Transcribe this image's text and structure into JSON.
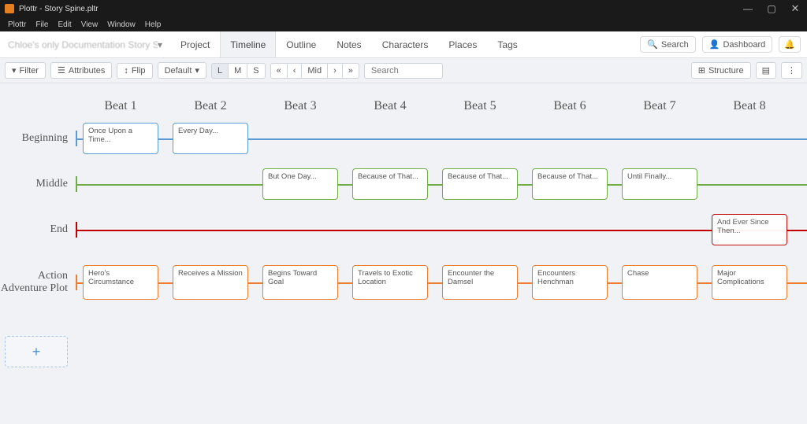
{
  "window": {
    "title": "Plottr - Story Spine.pltr",
    "controls": {
      "min": "—",
      "max": "▢",
      "close": "✕"
    }
  },
  "menubar": [
    "Plottr",
    "File",
    "Edit",
    "View",
    "Window",
    "Help"
  ],
  "mainnav": {
    "doc_title": "Chloe's only Documentation Story Spine...",
    "caret": "▾",
    "items": [
      "Project",
      "Timeline",
      "Outline",
      "Notes",
      "Characters",
      "Places",
      "Tags"
    ],
    "active": "Timeline",
    "right": {
      "search_label": "Search",
      "dashboard_label": "Dashboard",
      "bell": "🔔"
    }
  },
  "toolbar": {
    "filter": "Filter",
    "attributes": "Attributes",
    "flip": "Flip",
    "default": "Default",
    "zoom": [
      "L",
      "M",
      "S"
    ],
    "zoom_active": "L",
    "pager": [
      "«",
      "‹",
      "Mid",
      "›",
      "»"
    ],
    "search_placeholder": "Search",
    "structure": "Structure",
    "icon_layers": "≣",
    "icon_more": "⋮",
    "filter_icon": "⎔",
    "attr_icon": "☰",
    "flip_icon": "↕"
  },
  "beats": [
    "Beat 1",
    "Beat 2",
    "Beat 3",
    "Beat 4",
    "Beat 5",
    "Beat 6",
    "Beat 7",
    "Beat 8"
  ],
  "plotlines": [
    {
      "name": "Beginning",
      "color": "blue",
      "cards": [
        {
          "beat": 0,
          "text": "Once Upon a Time..."
        },
        {
          "beat": 1,
          "text": "Every Day..."
        }
      ]
    },
    {
      "name": "Middle",
      "color": "green",
      "cards": [
        {
          "beat": 2,
          "text": "But One Day..."
        },
        {
          "beat": 3,
          "text": "Because of That..."
        },
        {
          "beat": 4,
          "text": "Because of That..."
        },
        {
          "beat": 5,
          "text": "Because of That..."
        },
        {
          "beat": 6,
          "text": "Until Finally..."
        }
      ]
    },
    {
      "name": "End",
      "color": "red",
      "cards": [
        {
          "beat": 7,
          "text": "And Ever Since Then..."
        }
      ]
    },
    {
      "name": "Action Adventure Plot",
      "color": "orange",
      "tall": true,
      "cards": [
        {
          "beat": 0,
          "text": "Hero's Circumstance"
        },
        {
          "beat": 1,
          "text": "Receives a Mission"
        },
        {
          "beat": 2,
          "text": "Begins Toward Goal"
        },
        {
          "beat": 3,
          "text": "Travels to Exotic Location"
        },
        {
          "beat": 4,
          "text": "Encounter the Damsel"
        },
        {
          "beat": 5,
          "text": "Encounters Henchman"
        },
        {
          "beat": 6,
          "text": "Chase"
        },
        {
          "beat": 7,
          "text": "Major Complications"
        }
      ]
    }
  ],
  "add_button": "+"
}
